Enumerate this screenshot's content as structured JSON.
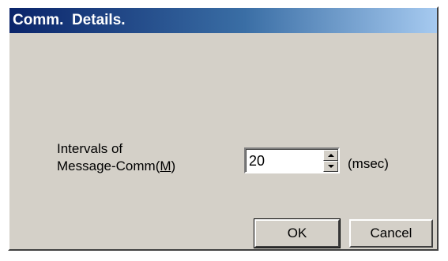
{
  "window": {
    "title": "Comm.  Details."
  },
  "form": {
    "interval_label_line1": "Intervals of",
    "interval_label_line2_prefix": "Message-Comm(",
    "interval_label_mnemonic": "M",
    "interval_label_line2_suffix": ")",
    "interval_value": "20",
    "unit": "(msec)"
  },
  "buttons": {
    "ok": "OK",
    "cancel": "Cancel"
  },
  "colors": {
    "title_gradient_start": "#0a246a",
    "title_gradient_end": "#a6caf0",
    "dialog_face": "#d4d0c8"
  },
  "icons": {
    "spin_up": "spin-up-arrow-icon",
    "spin_down": "spin-down-arrow-icon"
  }
}
